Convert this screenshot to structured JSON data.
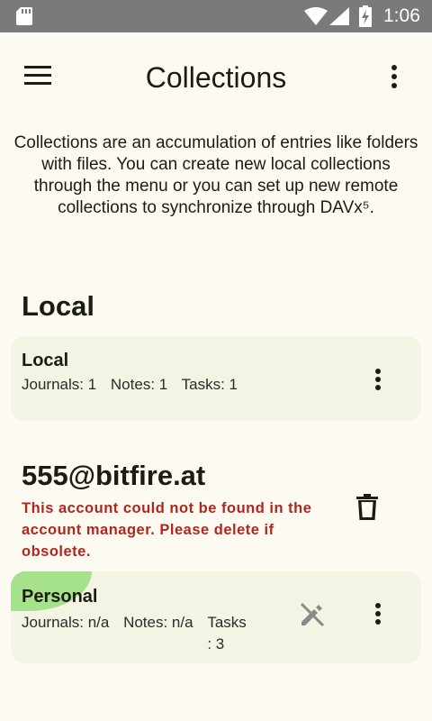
{
  "status_bar": {
    "time": "1:06",
    "icons": [
      "sd-card-icon",
      "wifi-icon",
      "cell-signal-icon",
      "battery-charging-icon"
    ]
  },
  "app_bar": {
    "title": "Collections",
    "icons": [
      "menu-icon",
      "more-vert-icon"
    ]
  },
  "intro_text": "Collections are an accumulation of entries like folders with files. You can create new local collections through the menu or you can set up new remote collections to synchronize through DAVx⁵.",
  "sections": [
    {
      "title": "Local",
      "collections": [
        {
          "name": "Local",
          "journals": "Journals: 1",
          "notes": "Notes: 1",
          "tasks": "Tasks: 1"
        }
      ]
    },
    {
      "title": "555@bitfire.at",
      "warning": "This account could not be found in the account manager. Please delete if obsolete.",
      "collections": [
        {
          "name": "Personal",
          "color": "#a6e28c",
          "journals": "Journals: n/a",
          "notes": "Notes: n/a",
          "tasks_line1": "Tasks",
          "tasks_line2": ": 3",
          "read_only": true
        }
      ]
    }
  ],
  "colors": {
    "background": "#fdfbf1",
    "card": "#f3f4e3",
    "warning": "#b3261e",
    "status_bar": "#7a7a7a"
  }
}
